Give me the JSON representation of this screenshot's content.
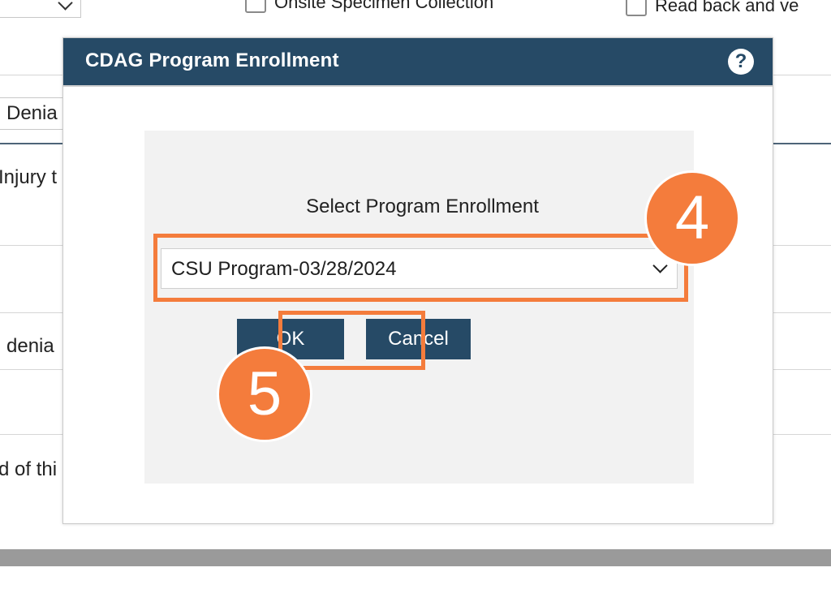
{
  "background": {
    "checkbox_onsite": "Onsite Specimen Collection",
    "checkbox_readback": "Read back and ve",
    "field_value": "Denia",
    "text_row1": "Injury t",
    "text_row2": "denia",
    "text_row3": "d of thi"
  },
  "modal": {
    "title": "CDAG Program Enrollment",
    "help_glyph": "?",
    "prompt": "Select Program Enrollment",
    "select_value": "CSU Program-03/28/2024",
    "ok_label": "OK",
    "cancel_label": "Cancel"
  },
  "callouts": {
    "step_select": "4",
    "step_ok": "5",
    "color": "#f47c3c"
  },
  "colors": {
    "header": "#264a66",
    "button": "#264a66",
    "panel": "#f2f2f2"
  },
  "icons": {
    "help": "question-circle-icon",
    "select_arrow": "chevron-down-icon"
  }
}
